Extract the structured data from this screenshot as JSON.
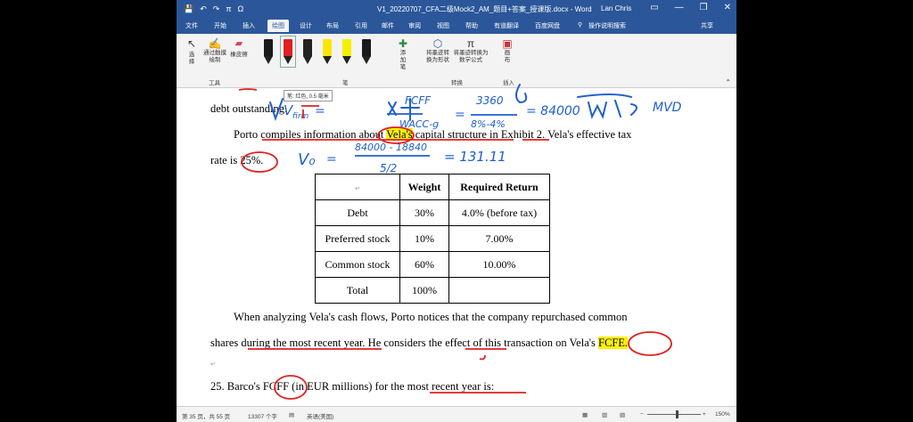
{
  "window": {
    "title": "V1_20220707_CFA二级Mock2_AM_题目+答案_授课版.docx - Word",
    "user": "Lan Chris",
    "quick_access": [
      "💾",
      "↶",
      "↷",
      "π",
      "Ω"
    ]
  },
  "menu": {
    "tabs": [
      "文件",
      "开始",
      "插入",
      "绘图",
      "设计",
      "布局",
      "引用",
      "邮件",
      "审阅",
      "视图",
      "帮助",
      "有道翻译",
      "百度网盘",
      "操作说明搜索"
    ],
    "share": "共享"
  },
  "ribbon": {
    "select": "选择",
    "touch_draw": "通过触摸绘制",
    "eraser": "橡皮擦",
    "tools_label": "工具",
    "add_pen": "添加笔",
    "pens_label": "笔",
    "ink_to_shape": "将墨迹转换为形状",
    "ink_to_math": "将墨迹转换为数学公式",
    "convert_label": "转换",
    "canvas": "画布",
    "insert_label": "插入",
    "tooltip": "笔: 红色, 0.5 毫米",
    "pen_colors": [
      "#1a1a1a",
      "#e02020",
      "#222222",
      "#ffe600",
      "#f5f000",
      "#1a1a1a"
    ]
  },
  "document": {
    "line1": "debt outstanding.",
    "line2_a": "Porto compiles information about ",
    "line2_vela": "Vela's",
    "line2_b": " capital structure in Exhibit 2. Vela's effective tax",
    "line3": "rate is 25%.",
    "table": {
      "headers": [
        "",
        "Weight",
        "Required Return"
      ],
      "rows": [
        [
          "Debt",
          "30%",
          "4.0% (before tax)"
        ],
        [
          "Preferred stock",
          "10%",
          "7.00%"
        ],
        [
          "Common stock",
          "60%",
          "10.00%"
        ],
        [
          "Total",
          "100%",
          ""
        ]
      ]
    },
    "para2_line1": "When analyzing Vela's cash flows, Porto notices that the company repurchased common",
    "para2_line2_a": "shares during the most recent year. He considers the effect of this transaction on Vela's ",
    "para2_fcfe": "FCFE.",
    "q25": "25.  Barco's FCFF (in EUR millions) for the most recent year is:",
    "ink": {
      "eq1": "V_firm = FCFF / (WACC-g) = 3360 / (8%-4%) = 84000",
      "eq1_tail": "MVD",
      "eq2": "V₀ = (84000 - 18840) / 5/2 = 131.11"
    }
  },
  "status": {
    "page": "第 35 页，共 55 页",
    "words": "13307 个字",
    "lang": "英语(美国)",
    "zoom": "150%"
  }
}
